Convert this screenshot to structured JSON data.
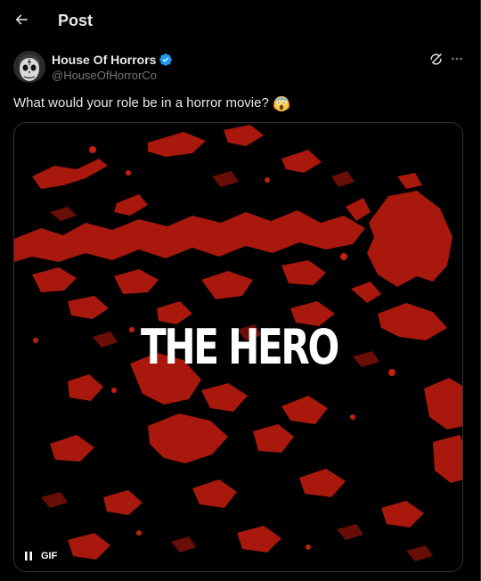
{
  "header": {
    "title": "Post",
    "back_icon": "arrow-left-icon"
  },
  "post": {
    "author": {
      "name": "House Of Horrors",
      "handle": "@HouseOfHorrorCo",
      "verified": true,
      "verified_color": "#1d9bf0",
      "avatar_icon": "skull-avatar"
    },
    "text": "What would your role be in a horror movie?",
    "emoji_icon": "screaming-face-emoji",
    "media": {
      "type": "gif",
      "caption": "THE HERO",
      "badge": "GIF",
      "accent_color": "#b81c0e",
      "playback_icon": "pause-icon"
    },
    "actions": {
      "grok_icon": "grok-icon",
      "more_icon": "more-horizontal-icon"
    }
  },
  "colors": {
    "background": "#000000",
    "text_primary": "#e7e9ea",
    "text_secondary": "#71767b",
    "border": "#2f3336"
  }
}
